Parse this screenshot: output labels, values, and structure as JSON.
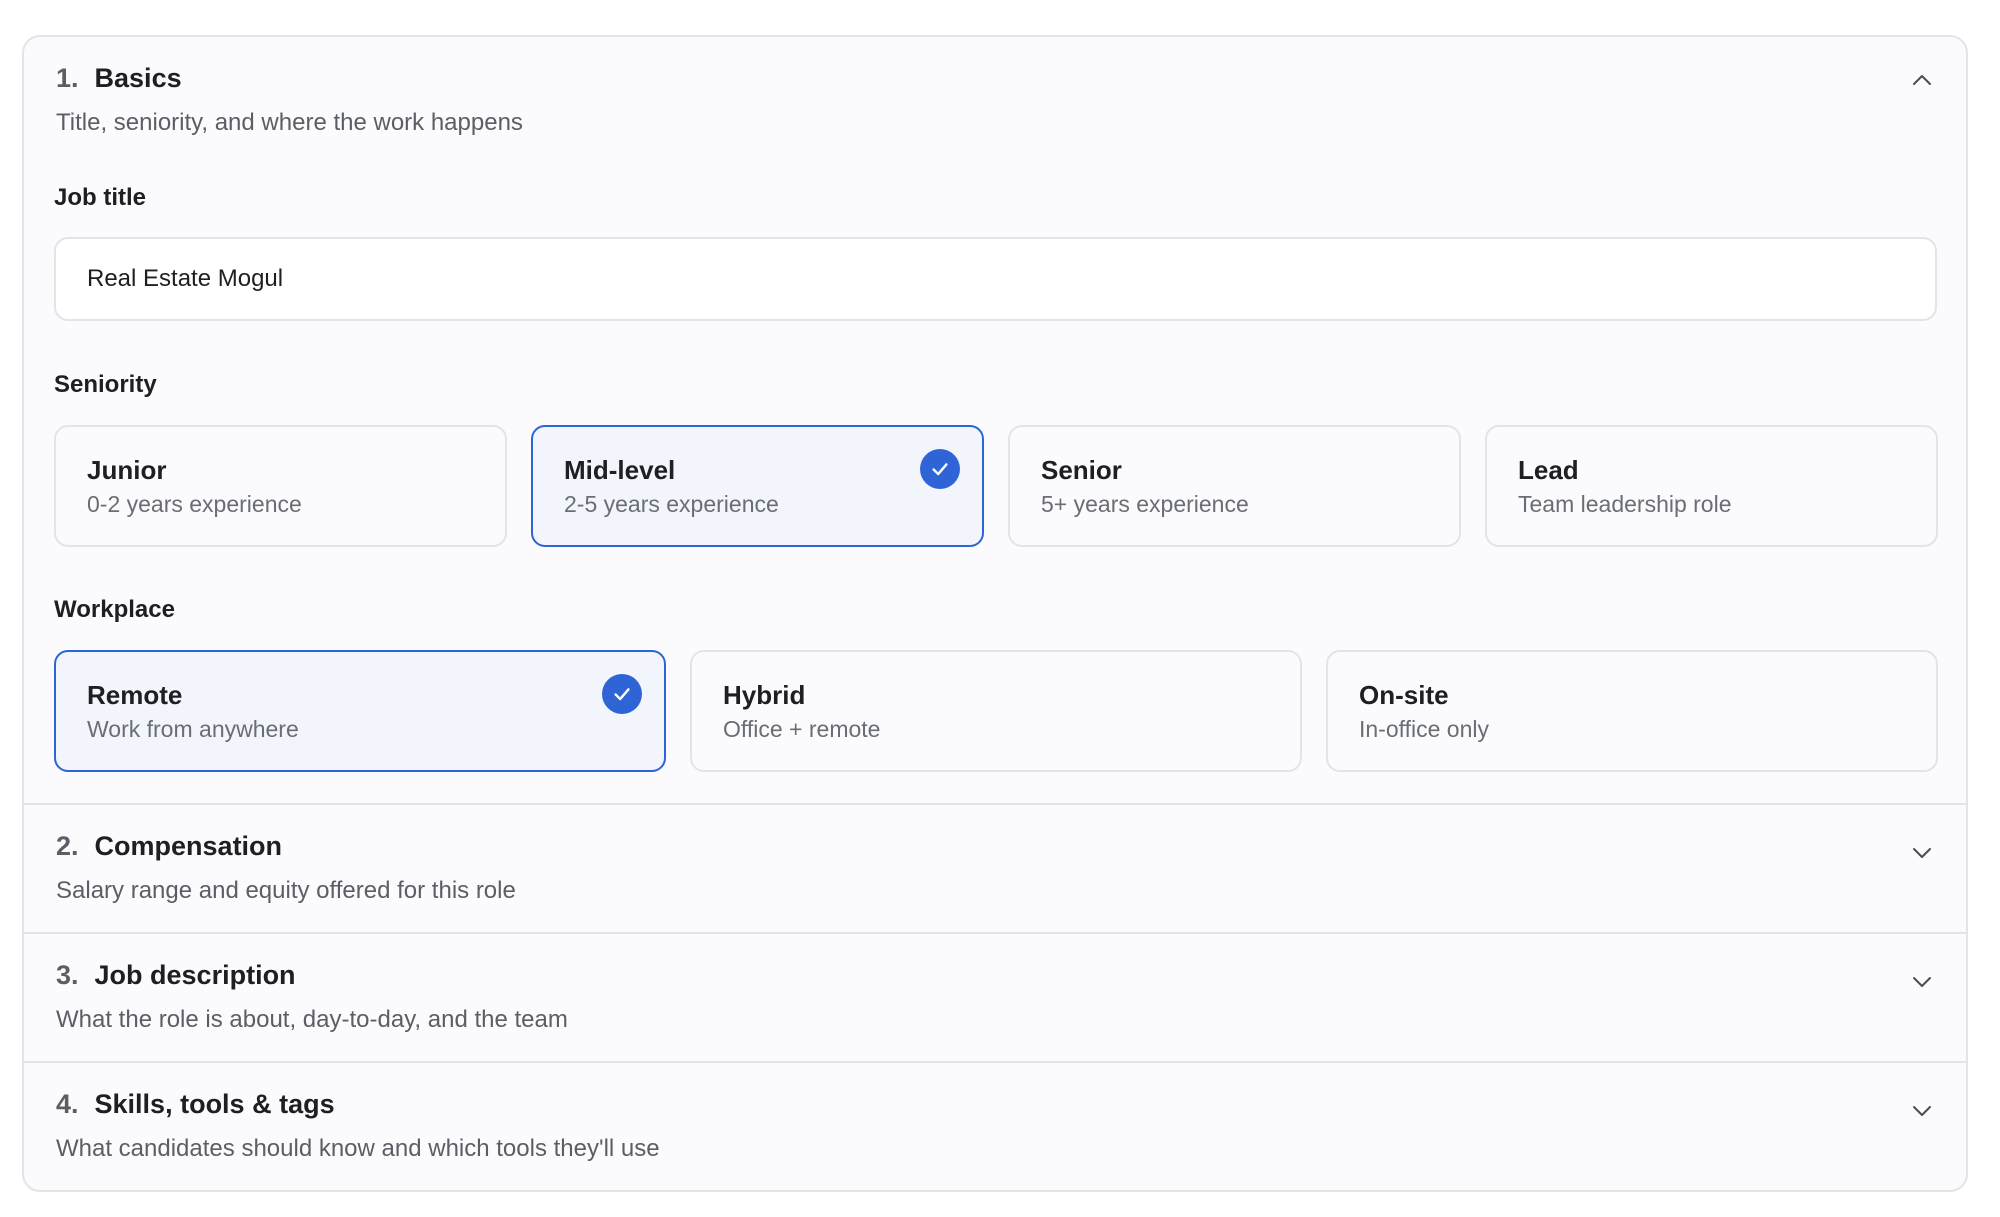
{
  "sections": [
    {
      "number": "1.",
      "title": "Basics",
      "subtitle": "Title, seniority, and where the work happens",
      "expanded": true,
      "chevron_icon": "chevron-up-icon"
    },
    {
      "number": "2.",
      "title": "Compensation",
      "subtitle": "Salary range and equity offered for this role",
      "expanded": false,
      "chevron_icon": "chevron-down-icon"
    },
    {
      "number": "3.",
      "title": "Job description",
      "subtitle": "What the role is about, day-to-day, and the team",
      "expanded": false,
      "chevron_icon": "chevron-down-icon"
    },
    {
      "number": "4.",
      "title": "Skills, tools & tags",
      "subtitle": "What candidates should know and which tools they'll use",
      "expanded": false,
      "chevron_icon": "chevron-down-icon"
    }
  ],
  "basics": {
    "job_title_label": "Job title",
    "job_title_value": "Real Estate Mogul",
    "seniority_label": "Seniority",
    "seniority_options": [
      {
        "title": "Junior",
        "desc": "0-2 years experience",
        "selected": false
      },
      {
        "title": "Mid-level",
        "desc": "2-5 years experience",
        "selected": true
      },
      {
        "title": "Senior",
        "desc": "5+ years experience",
        "selected": false
      },
      {
        "title": "Lead",
        "desc": "Team leadership role",
        "selected": false
      }
    ],
    "workplace_label": "Workplace",
    "workplace_options": [
      {
        "title": "Remote",
        "desc": "Work from anywhere",
        "selected": true
      },
      {
        "title": "Hybrid",
        "desc": "Office + remote",
        "selected": false
      },
      {
        "title": "On-site",
        "desc": "In-office only",
        "selected": false
      }
    ]
  },
  "colors": {
    "accent": "#2f64d6",
    "selected_bg": "#f2f5fc",
    "border": "#e3e4e8",
    "card_bg": "#fbfbfd",
    "muted_text": "#5b5e66"
  }
}
